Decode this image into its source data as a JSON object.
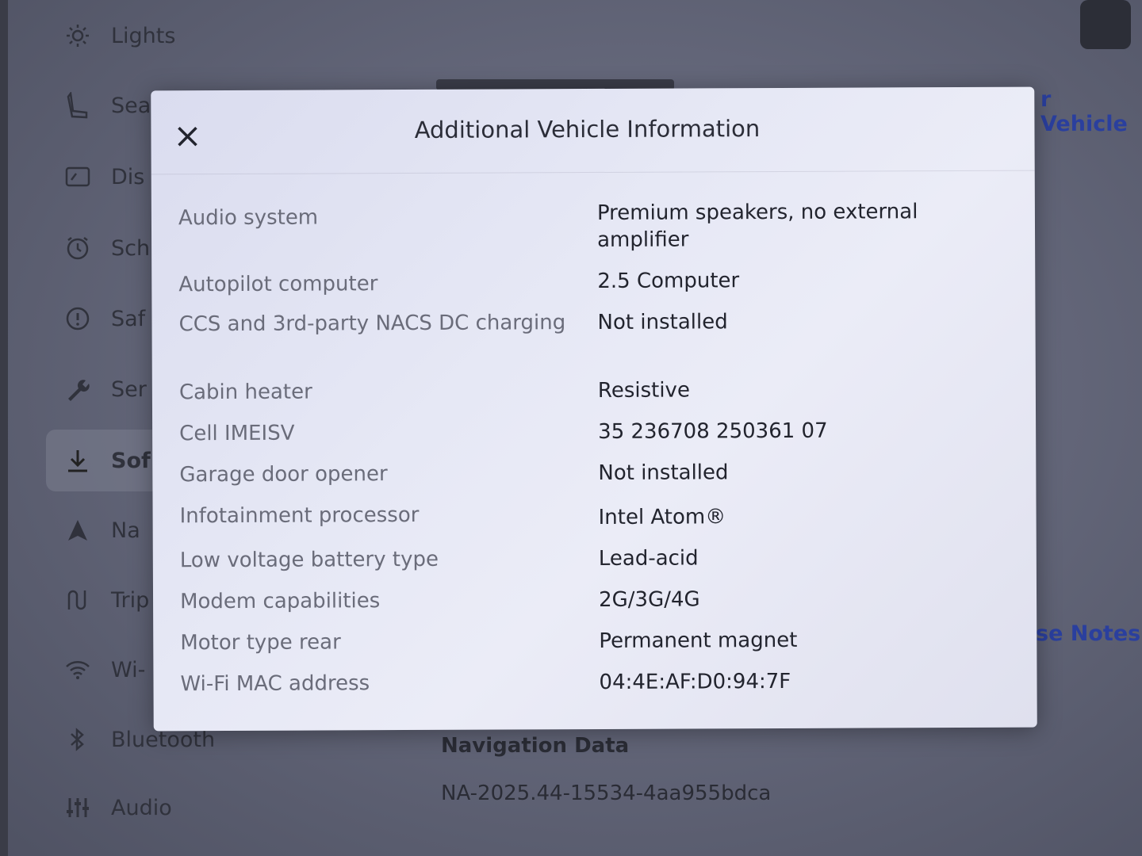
{
  "sidebar": {
    "items": [
      {
        "label": "Lights",
        "icon": "lightbulb-icon"
      },
      {
        "label": "Sea",
        "icon": "seat-icon"
      },
      {
        "label": "Dis",
        "icon": "display-icon"
      },
      {
        "label": "Sch",
        "icon": "alarm-clock-icon"
      },
      {
        "label": "Saf",
        "icon": "info-circle-icon"
      },
      {
        "label": "Ser",
        "icon": "wrench-icon"
      },
      {
        "label": "Sof",
        "icon": "download-icon"
      },
      {
        "label": "Na",
        "icon": "navigation-arrow-icon"
      },
      {
        "label": "Trip",
        "icon": "trips-icon"
      },
      {
        "label": "Wi-",
        "icon": "wifi-icon"
      },
      {
        "label": "Bluetooth",
        "icon": "bluetooth-icon"
      },
      {
        "label": "Audio",
        "icon": "equalizer-icon"
      }
    ]
  },
  "background": {
    "vehicle_link": "r Vehicle",
    "release_notes_link": "se Notes",
    "navigation_data_label": "Navigation Data",
    "navigation_data_value": "NA-2025.44-15534-4aa955bdca"
  },
  "modal": {
    "title": "Additional Vehicle Information",
    "rows": [
      {
        "label": "Audio system",
        "value": "Premium speakers, no external amplifier"
      },
      {
        "label": "Autopilot computer",
        "value": "2.5 Computer"
      },
      {
        "label": "CCS and 3rd-party NACS DC charging",
        "value": "Not installed"
      },
      {
        "label": "Cabin heater",
        "value": "Resistive"
      },
      {
        "label": "Cell IMEISV",
        "value": "35 236708 250361 07"
      },
      {
        "label": "Garage door opener",
        "value": "Not installed"
      },
      {
        "label": "Infotainment processor",
        "value": "Intel Atom®"
      },
      {
        "label": "Low voltage battery type",
        "value": "Lead-acid"
      },
      {
        "label": "Modem capabilities",
        "value": "2G/3G/4G"
      },
      {
        "label": "Motor type rear",
        "value": "Permanent magnet"
      },
      {
        "label": "Wi-Fi MAC address",
        "value": "04:4E:AF:D0:94:7F"
      }
    ]
  }
}
